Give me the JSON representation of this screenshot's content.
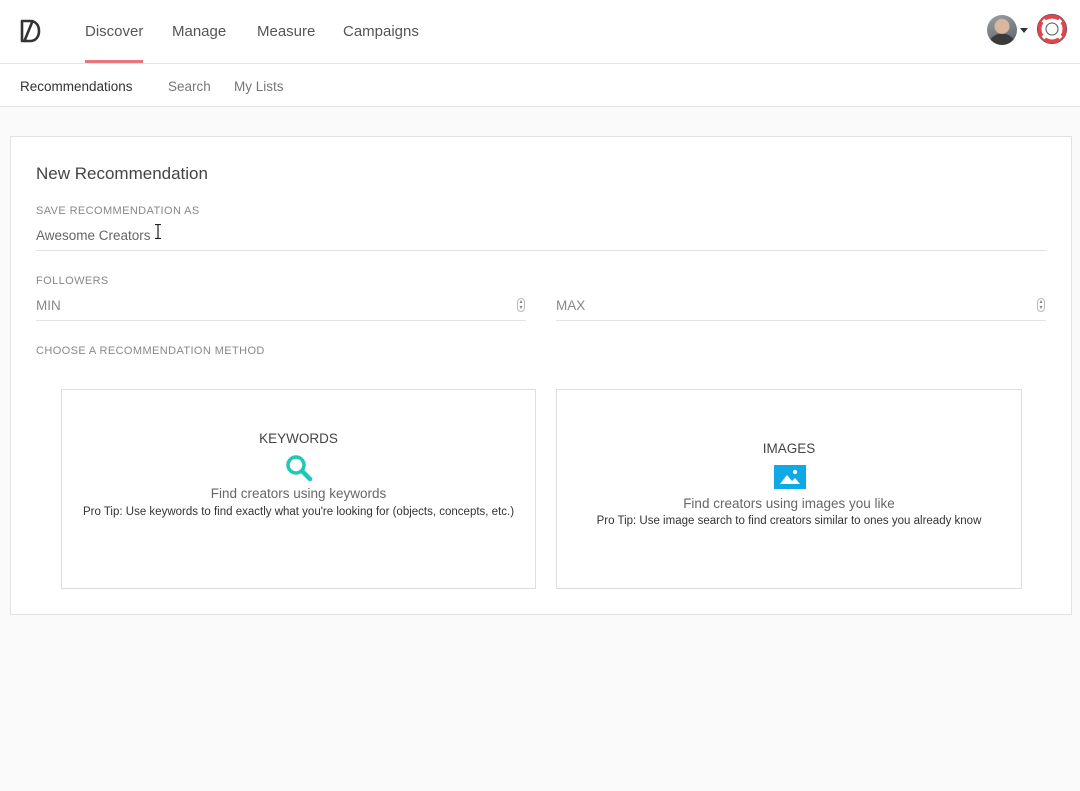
{
  "nav": {
    "items": [
      {
        "label": "Discover",
        "active": true
      },
      {
        "label": "Manage",
        "active": false
      },
      {
        "label": "Measure",
        "active": false
      },
      {
        "label": "Campaigns",
        "active": false
      }
    ],
    "accent_color": "#e8767e"
  },
  "subnav": {
    "items": [
      {
        "label": "Recommendations",
        "active": true
      },
      {
        "label": "Search",
        "active": false
      },
      {
        "label": "My Lists",
        "active": false
      }
    ]
  },
  "form": {
    "title": "New Recommendation",
    "save_as_label": "SAVE RECOMMENDATION AS",
    "save_as_value": "Awesome Creators",
    "followers_label": "FOLLOWERS",
    "min_placeholder": "MIN",
    "max_placeholder": "MAX",
    "method_label": "CHOOSE A RECOMMENDATION METHOD"
  },
  "methods": {
    "keywords": {
      "title": "KEYWORDS",
      "icon": "search-icon",
      "description": "Find creators using keywords",
      "tip": "Pro Tip: Use keywords to find exactly what you're looking for (objects, concepts, etc.)",
      "icon_color": "#1ec8b4"
    },
    "images": {
      "title": "IMAGES",
      "icon": "image-icon",
      "description": "Find creators using images you like",
      "tip": "Pro Tip: Use image search to find creators similar to ones you already know",
      "icon_color": "#0fa9e6"
    }
  }
}
